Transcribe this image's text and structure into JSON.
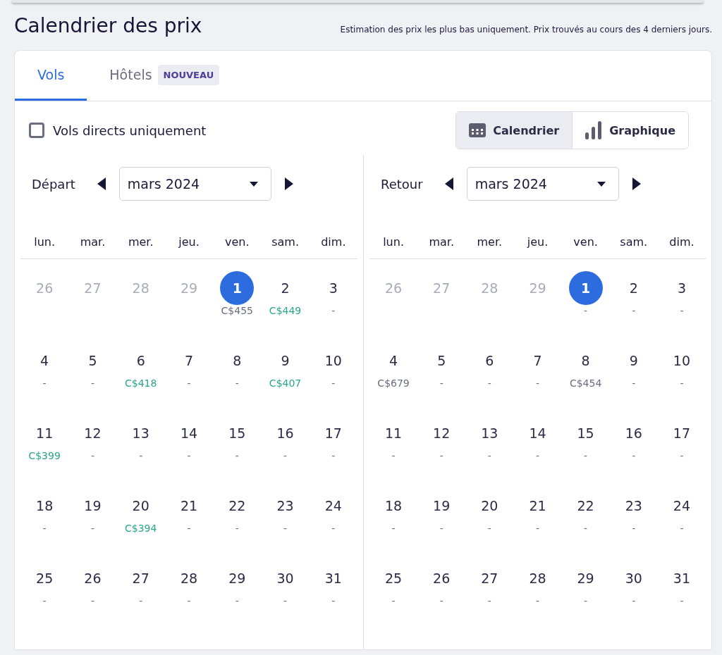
{
  "title": "Calendrier des prix",
  "note": "Estimation des prix les plus bas uniquement. Prix trouvés au cours des 4 derniers jours.",
  "tabs": [
    {
      "label": "Vols",
      "selected": true
    },
    {
      "label": "Hôtels",
      "selected": false,
      "badge": "NOUVEAU"
    }
  ],
  "direct_only": {
    "label": "Vols directs uniquement",
    "checked": false
  },
  "view_toggle": [
    {
      "label": "Calendrier",
      "kind": "calendar",
      "selected": true
    },
    {
      "label": "Graphique",
      "kind": "chart",
      "selected": false
    }
  ],
  "calendars": [
    {
      "label": "Départ",
      "month": "mars 2024",
      "weekdays": [
        "lun.",
        "mar.",
        "mer.",
        "jeu.",
        "ven.",
        "sam.",
        "dim."
      ],
      "days": [
        {
          "day": "26",
          "outside": true,
          "selected": false
        },
        {
          "day": "27",
          "outside": true,
          "selected": false
        },
        {
          "day": "28",
          "outside": true,
          "selected": false
        },
        {
          "day": "29",
          "outside": true,
          "selected": false
        },
        {
          "day": "1",
          "outside": false,
          "selected": true,
          "price": "C$455",
          "cheap": false
        },
        {
          "day": "2",
          "outside": false,
          "selected": false,
          "price": "C$449",
          "cheap": true
        },
        {
          "day": "3",
          "outside": false,
          "selected": false,
          "price": "-",
          "cheap": false
        },
        {
          "day": "4",
          "outside": false,
          "selected": false,
          "price": "-",
          "cheap": false
        },
        {
          "day": "5",
          "outside": false,
          "selected": false,
          "price": "-",
          "cheap": false
        },
        {
          "day": "6",
          "outside": false,
          "selected": false,
          "price": "C$418",
          "cheap": true
        },
        {
          "day": "7",
          "outside": false,
          "selected": false,
          "price": "-",
          "cheap": false
        },
        {
          "day": "8",
          "outside": false,
          "selected": false,
          "price": "-",
          "cheap": false
        },
        {
          "day": "9",
          "outside": false,
          "selected": false,
          "price": "C$407",
          "cheap": true
        },
        {
          "day": "10",
          "outside": false,
          "selected": false,
          "price": "-",
          "cheap": false
        },
        {
          "day": "11",
          "outside": false,
          "selected": false,
          "price": "C$399",
          "cheap": true
        },
        {
          "day": "12",
          "outside": false,
          "selected": false,
          "price": "-",
          "cheap": false
        },
        {
          "day": "13",
          "outside": false,
          "selected": false,
          "price": "-",
          "cheap": false
        },
        {
          "day": "14",
          "outside": false,
          "selected": false,
          "price": "-",
          "cheap": false
        },
        {
          "day": "15",
          "outside": false,
          "selected": false,
          "price": "-",
          "cheap": false
        },
        {
          "day": "16",
          "outside": false,
          "selected": false,
          "price": "-",
          "cheap": false
        },
        {
          "day": "17",
          "outside": false,
          "selected": false,
          "price": "-",
          "cheap": false
        },
        {
          "day": "18",
          "outside": false,
          "selected": false,
          "price": "-",
          "cheap": false
        },
        {
          "day": "19",
          "outside": false,
          "selected": false,
          "price": "-",
          "cheap": false
        },
        {
          "day": "20",
          "outside": false,
          "selected": false,
          "price": "C$394",
          "cheap": true
        },
        {
          "day": "21",
          "outside": false,
          "selected": false,
          "price": "-",
          "cheap": false
        },
        {
          "day": "22",
          "outside": false,
          "selected": false,
          "price": "-",
          "cheap": false
        },
        {
          "day": "23",
          "outside": false,
          "selected": false,
          "price": "-",
          "cheap": false
        },
        {
          "day": "24",
          "outside": false,
          "selected": false,
          "price": "-",
          "cheap": false
        },
        {
          "day": "25",
          "outside": false,
          "selected": false,
          "price": "-",
          "cheap": false
        },
        {
          "day": "26",
          "outside": false,
          "selected": false,
          "price": "-",
          "cheap": false
        },
        {
          "day": "27",
          "outside": false,
          "selected": false,
          "price": "-",
          "cheap": false
        },
        {
          "day": "28",
          "outside": false,
          "selected": false,
          "price": "-",
          "cheap": false
        },
        {
          "day": "29",
          "outside": false,
          "selected": false,
          "price": "-",
          "cheap": false
        },
        {
          "day": "30",
          "outside": false,
          "selected": false,
          "price": "-",
          "cheap": false
        },
        {
          "day": "31",
          "outside": false,
          "selected": false,
          "price": "-",
          "cheap": false
        }
      ]
    },
    {
      "label": "Retour",
      "month": "mars 2024",
      "weekdays": [
        "lun.",
        "mar.",
        "mer.",
        "jeu.",
        "ven.",
        "sam.",
        "dim."
      ],
      "days": [
        {
          "day": "26",
          "outside": true,
          "selected": false
        },
        {
          "day": "27",
          "outside": true,
          "selected": false
        },
        {
          "day": "28",
          "outside": true,
          "selected": false
        },
        {
          "day": "29",
          "outside": true,
          "selected": false
        },
        {
          "day": "1",
          "outside": false,
          "selected": true,
          "price": "-",
          "cheap": false
        },
        {
          "day": "2",
          "outside": false,
          "selected": false,
          "price": "-",
          "cheap": false
        },
        {
          "day": "3",
          "outside": false,
          "selected": false,
          "price": "-",
          "cheap": false
        },
        {
          "day": "4",
          "outside": false,
          "selected": false,
          "price": "C$679",
          "cheap": false
        },
        {
          "day": "5",
          "outside": false,
          "selected": false,
          "price": "-",
          "cheap": false
        },
        {
          "day": "6",
          "outside": false,
          "selected": false,
          "price": "-",
          "cheap": false
        },
        {
          "day": "7",
          "outside": false,
          "selected": false,
          "price": "-",
          "cheap": false
        },
        {
          "day": "8",
          "outside": false,
          "selected": false,
          "price": "C$454",
          "cheap": false
        },
        {
          "day": "9",
          "outside": false,
          "selected": false,
          "price": "-",
          "cheap": false
        },
        {
          "day": "10",
          "outside": false,
          "selected": false,
          "price": "-",
          "cheap": false
        },
        {
          "day": "11",
          "outside": false,
          "selected": false,
          "price": "-",
          "cheap": false
        },
        {
          "day": "12",
          "outside": false,
          "selected": false,
          "price": "-",
          "cheap": false
        },
        {
          "day": "13",
          "outside": false,
          "selected": false,
          "price": "-",
          "cheap": false
        },
        {
          "day": "14",
          "outside": false,
          "selected": false,
          "price": "-",
          "cheap": false
        },
        {
          "day": "15",
          "outside": false,
          "selected": false,
          "price": "-",
          "cheap": false
        },
        {
          "day": "16",
          "outside": false,
          "selected": false,
          "price": "-",
          "cheap": false
        },
        {
          "day": "17",
          "outside": false,
          "selected": false,
          "price": "-",
          "cheap": false
        },
        {
          "day": "18",
          "outside": false,
          "selected": false,
          "price": "-",
          "cheap": false
        },
        {
          "day": "19",
          "outside": false,
          "selected": false,
          "price": "-",
          "cheap": false
        },
        {
          "day": "20",
          "outside": false,
          "selected": false,
          "price": "-",
          "cheap": false
        },
        {
          "day": "21",
          "outside": false,
          "selected": false,
          "price": "-",
          "cheap": false
        },
        {
          "day": "22",
          "outside": false,
          "selected": false,
          "price": "-",
          "cheap": false
        },
        {
          "day": "23",
          "outside": false,
          "selected": false,
          "price": "-",
          "cheap": false
        },
        {
          "day": "24",
          "outside": false,
          "selected": false,
          "price": "-",
          "cheap": false
        },
        {
          "day": "25",
          "outside": false,
          "selected": false,
          "price": "-",
          "cheap": false
        },
        {
          "day": "26",
          "outside": false,
          "selected": false,
          "price": "-",
          "cheap": false
        },
        {
          "day": "27",
          "outside": false,
          "selected": false,
          "price": "-",
          "cheap": false
        },
        {
          "day": "28",
          "outside": false,
          "selected": false,
          "price": "-",
          "cheap": false
        },
        {
          "day": "29",
          "outside": false,
          "selected": false,
          "price": "-",
          "cheap": false
        },
        {
          "day": "30",
          "outside": false,
          "selected": false,
          "price": "-",
          "cheap": false
        },
        {
          "day": "31",
          "outside": false,
          "selected": false,
          "price": "-",
          "cheap": false
        }
      ]
    }
  ]
}
